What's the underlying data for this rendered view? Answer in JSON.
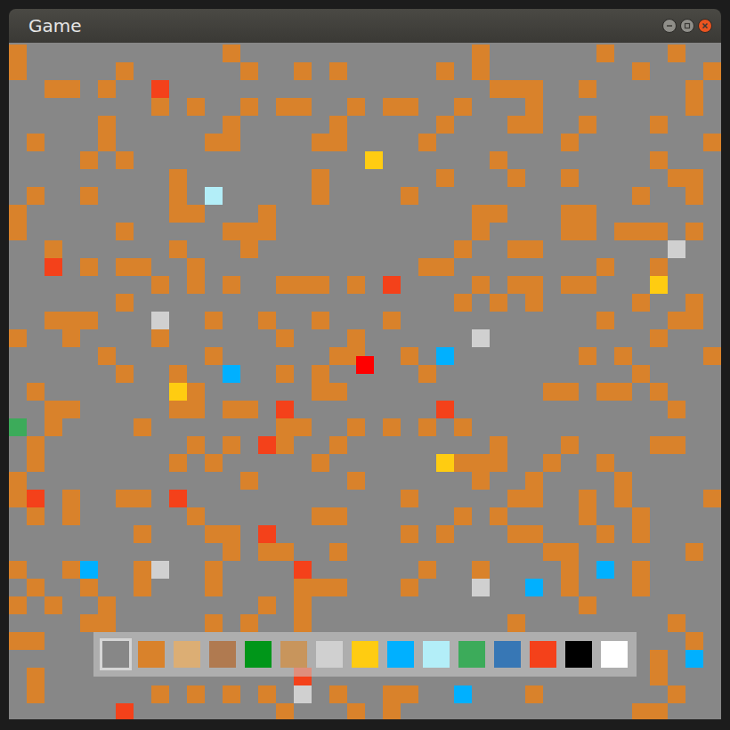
{
  "window": {
    "title": "Game"
  },
  "tiles": [
    {
      "kind": "dirt",
      "symbol": "d",
      "color": "#d9822b"
    },
    {
      "kind": "lava",
      "symbol": "r",
      "color": "#f4411a"
    },
    {
      "kind": "gold",
      "symbol": "y",
      "color": "#ffcc11"
    },
    {
      "kind": "water",
      "symbol": "c",
      "color": "#00b0ff"
    },
    {
      "kind": "diamond",
      "symbol": "b",
      "color": "#b3eef8"
    },
    {
      "kind": "iron",
      "symbol": "i",
      "color": "#d0d0d0"
    },
    {
      "kind": "grass",
      "symbol": "g",
      "color": "#3cab5a"
    }
  ],
  "world": {
    "rows": [
      "d...........d.............d......d...d..",
      "d.....d......d..d.d.....d.d........d...d",
      "..dd.d..r..................ddd..d.....d...",
      "........d.d..d.dd..d.dd..d...d........d.",
      ".....d......d.....d.....d...dd..d...d...",
      ".d...d.....dd....dd....d.......d.......d",
      "....d.d.............y......d........d.",
      ".........d.......d......d...d..d.....dd.",
      ".d..d....d.b.....d....d............d..d.",
      "d........dd...d...........dd...dd.......",
      "d.....d.....ddd...........d....dd.ddd.d.",
      "..d......d...d...........d..dd.......i..",
      "..r.d.dd..d............dd........d..d...",
      "........d.d.d..ddd.d.r....d.dd.dd...y...",
      "......d..................d.d.d.....d..d.",
      "..ddd...i..d..d..d...d...........d...dd.",
      "d..d....d......d...d......i.........d...",
      ".....d.....d......dd..d.c.......d.d....d.",
      "......d..d..c..d.d.....d...........d....",
      ".d.......yd......dd...........dd.dd.d..",
      "..dd.....dd.dd.r........r............d..",
      "g.d....d.......dd..d.d.d.d..............",
      ".d........d.d.rd..d........d...d....dd..",
      ".d.......d.d.....d......yddd..d..d......",
      "d............d.....d......d..d....d.....",
      "dr.d..dd.r............d.....dd..d.d....d",
      ".d.d......d......dd......d.d....d..d....",
      ".......d...dd.r.......d.d...dd...d.d....",
      "............d.dd..d...........dd......d.",
      "d..dc..di..d....r......d..d....d.c.d....",
      ".d..d..d...d....ddd...d...i..c.d...d....",
      "d.d..d........d.d...............d........",
      "....dd.....d.d..d...........d........d..",
      "dd....................................d.",
      "....................................d.c.",
      ".d..............r...................d...",
      ".d......d.d.d.d.i.d..dd..c...d.......d..",
      "......r........d...d.d.............dd..."
    ]
  },
  "hotbar": [
    {
      "color": "#878787",
      "selected": true
    },
    {
      "color": "#d9822b",
      "selected": false
    },
    {
      "color": "#dcae74",
      "selected": false
    },
    {
      "color": "#b07a50",
      "selected": false
    },
    {
      "color": "#009619",
      "selected": false
    },
    {
      "color": "#c8955c",
      "selected": false
    },
    {
      "color": "#d0d0d0",
      "selected": false
    },
    {
      "color": "#ffcc11",
      "selected": false
    },
    {
      "color": "#00b0ff",
      "selected": false
    },
    {
      "color": "#b3eef8",
      "selected": false
    },
    {
      "color": "#3cab5a",
      "selected": false
    },
    {
      "color": "#3777b5",
      "selected": false
    },
    {
      "color": "#f4411a",
      "selected": false
    },
    {
      "color": "#000000",
      "selected": false
    },
    {
      "color": "#ffffff",
      "selected": false
    }
  ]
}
